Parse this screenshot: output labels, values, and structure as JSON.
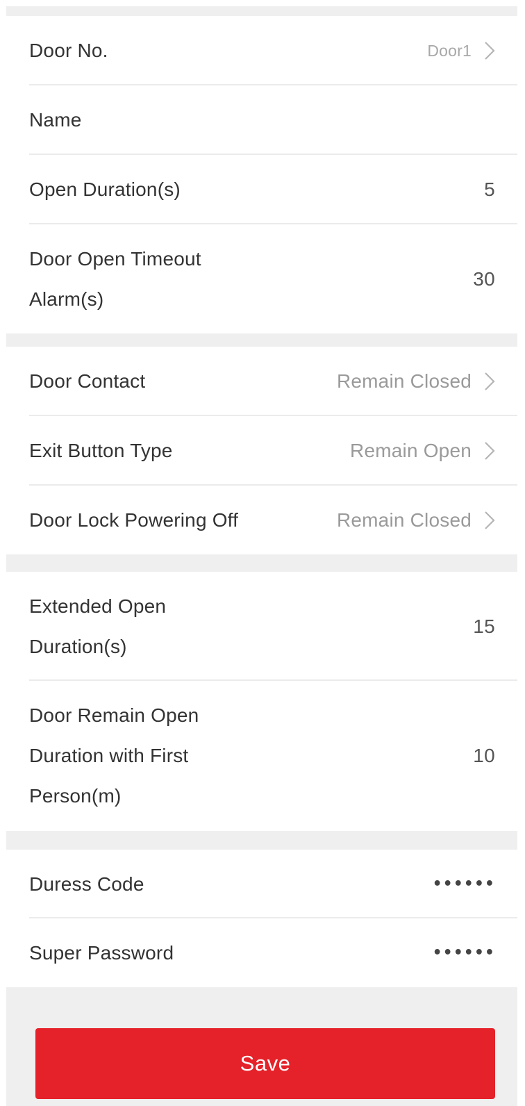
{
  "form": {
    "door_no": {
      "label": "Door No.",
      "value": "Door1"
    },
    "name": {
      "label": "Name",
      "value": ""
    },
    "open_duration": {
      "label": "Open Duration(s)",
      "value": "5"
    },
    "door_open_timeout_alarm": {
      "label": "Door Open Timeout Alarm(s)",
      "value": "30"
    },
    "door_contact": {
      "label": "Door Contact",
      "value": "Remain Closed"
    },
    "exit_button_type": {
      "label": "Exit Button Type",
      "value": "Remain Open"
    },
    "door_lock_powering_off": {
      "label": "Door Lock Powering Off",
      "value": "Remain Closed"
    },
    "extended_open_duration": {
      "label": "Extended Open Duration(s)",
      "value": "15"
    },
    "door_remain_open_first_person": {
      "label": "Door Remain Open Duration with First Person(m)",
      "value": "10"
    },
    "duress_code": {
      "label": "Duress Code",
      "value": "••••••"
    },
    "super_password": {
      "label": "Super Password",
      "value": "••••••"
    }
  },
  "actions": {
    "save_label": "Save"
  },
  "icons": {
    "chevron": "chevron-right-icon"
  },
  "colors": {
    "accent": "#e52129",
    "background": "#efefef",
    "card": "#ffffff",
    "label": "#333333",
    "option": "#9a9a9a"
  }
}
